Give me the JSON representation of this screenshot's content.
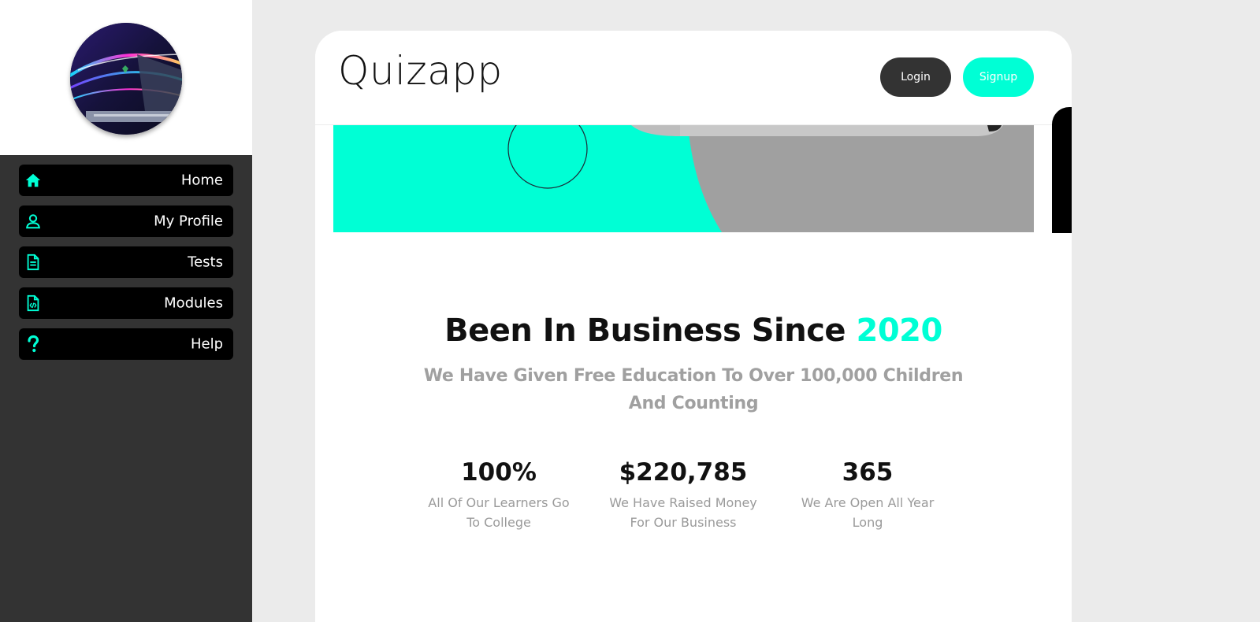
{
  "sidebar": {
    "items": [
      {
        "label": "Home",
        "icon": "home-icon"
      },
      {
        "label": "My Profile",
        "icon": "user-icon"
      },
      {
        "label": "Tests",
        "icon": "document-icon"
      },
      {
        "label": "Modules",
        "icon": "code-file-icon"
      },
      {
        "label": "Help",
        "icon": "question-icon"
      }
    ]
  },
  "header": {
    "brand": "Quizapp",
    "login_label": "Login",
    "signup_label": "Signup"
  },
  "business": {
    "headline": "Been In Business Since",
    "headline_accent": "2020",
    "subline": "We Have Given Free Education To Over 100,000 Children And Counting",
    "stats": [
      {
        "value": "100%",
        "label": "All Of Our Learners Go To College"
      },
      {
        "value": "$220,785",
        "label": "We Have Raised Money For Our Business"
      },
      {
        "value": "365",
        "label": "We Are Open All Year Long"
      }
    ]
  },
  "colors": {
    "accent": "#00ffd5",
    "sidebar_bg": "#333333",
    "nav_item_bg": "#000000",
    "page_bg": "#ebebeb",
    "muted_text": "#a0a0a0"
  }
}
